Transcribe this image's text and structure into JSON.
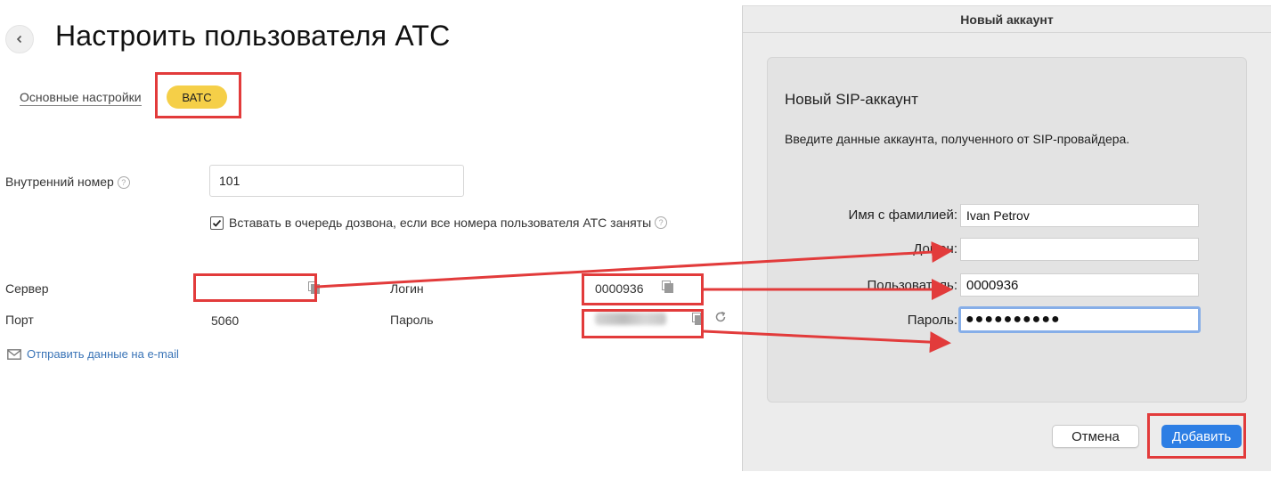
{
  "left": {
    "title": "Настроить пользователя АТС",
    "tabs": {
      "main": "Основные настройки",
      "vats": "ВАТС"
    },
    "internal_number": {
      "label": "Внутренний номер",
      "value": "101"
    },
    "queue_checkbox": {
      "label": "Вставать в очередь дозвона, если все номера пользователя АТС заняты",
      "checked": true
    },
    "server": {
      "label": "Сервер",
      "value": ""
    },
    "port": {
      "label": "Порт",
      "value": "5060"
    },
    "login": {
      "label": "Логин",
      "value": "0000936"
    },
    "password": {
      "label": "Пароль"
    },
    "email_link": "Отправить данные на e-mail",
    "accent_color": "#f5cf48",
    "link_color": "#3a74b7"
  },
  "dialog": {
    "window_title": "Новый аккаунт",
    "heading": "Новый SIP-аккаунт",
    "subtitle": "Введите данные аккаунта, полученного от SIP-провайдера.",
    "fields": {
      "name": {
        "label": "Имя с фамилией:",
        "value": "Ivan Petrov"
      },
      "domain": {
        "label": "Домен:",
        "value": ""
      },
      "user": {
        "label": "Пользователь:",
        "value": "0000936"
      },
      "password": {
        "label": "Пароль:",
        "value": "●●●●●●●●●●"
      }
    },
    "cancel_label": "Отмена",
    "add_label": "Добавить",
    "primary_color": "#2d7ee4"
  },
  "annotation_color": "#e23b3b"
}
